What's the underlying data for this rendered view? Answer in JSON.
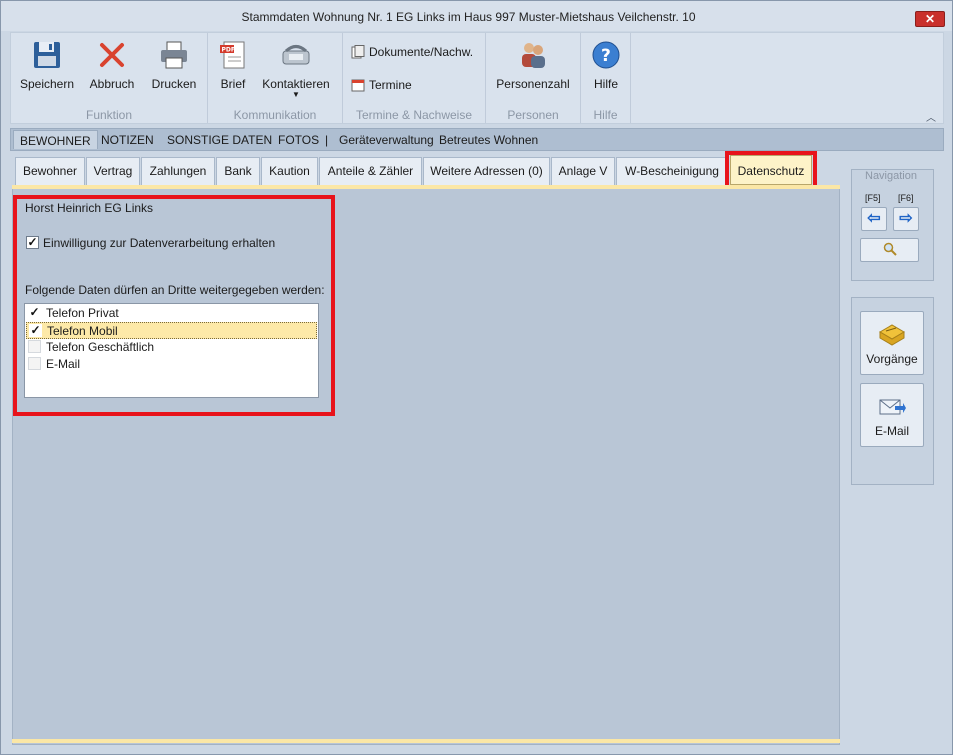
{
  "window": {
    "title": "Stammdaten Wohnung Nr. 1 EG Links im Haus 997  Muster-Mietshaus Veilchenstr. 10",
    "close_label": "✕"
  },
  "ribbon": {
    "groups": [
      {
        "label": "Funktion"
      },
      {
        "label": "Kommunikation"
      },
      {
        "label": "Termine & Nachweise"
      },
      {
        "label": "Personen"
      },
      {
        "label": "Hilfe"
      }
    ],
    "buttons": {
      "save": "Speichern",
      "cancel": "Abbruch",
      "print": "Drucken",
      "letter": "Brief",
      "contact": "Kontaktieren",
      "documents": "Dokumente/Nachw.",
      "appointments": "Termine",
      "persons": "Personenzahl",
      "help": "Hilfe"
    }
  },
  "sections": {
    "items": [
      "BEWOHNER",
      "NOTIZEN",
      "SONSTIGE DATEN",
      "FOTOS",
      "|",
      "Geräteverwaltung",
      "Betreutes Wohnen"
    ],
    "active": "BEWOHNER"
  },
  "tabs": [
    "Bewohner",
    "Vertrag",
    "Zahlungen",
    "Bank",
    "Kaution",
    "Anteile & Zähler",
    "Weitere Adressen (0)",
    "Anlage V",
    "W-Bescheinigung",
    "Datenschutz"
  ],
  "active_tab": "Datenschutz",
  "privacy": {
    "person_name": "Horst Heinrich EG Links",
    "consent_label": "Einwilligung zur Datenverarbeitung erhalten",
    "consent_checked": true,
    "share_heading": "Folgende Daten dürfen an Dritte weitergegeben werden:",
    "items": [
      {
        "label": "Telefon Privat",
        "checked": true,
        "selected": false
      },
      {
        "label": "Telefon Mobil",
        "checked": true,
        "selected": true
      },
      {
        "label": "Telefon Geschäftlich",
        "checked": false,
        "selected": false
      },
      {
        "label": "E-Mail",
        "checked": false,
        "selected": false
      }
    ]
  },
  "navigation": {
    "title": "Navigation",
    "prev_key": "[F5]",
    "next_key": "[F6]"
  },
  "actions": {
    "processes": "Vorgänge",
    "email": "E-Mail"
  },
  "colors": {
    "highlight": "#e8131b",
    "active_tab": "#fdf3c8",
    "content": "#b9c6d6"
  }
}
